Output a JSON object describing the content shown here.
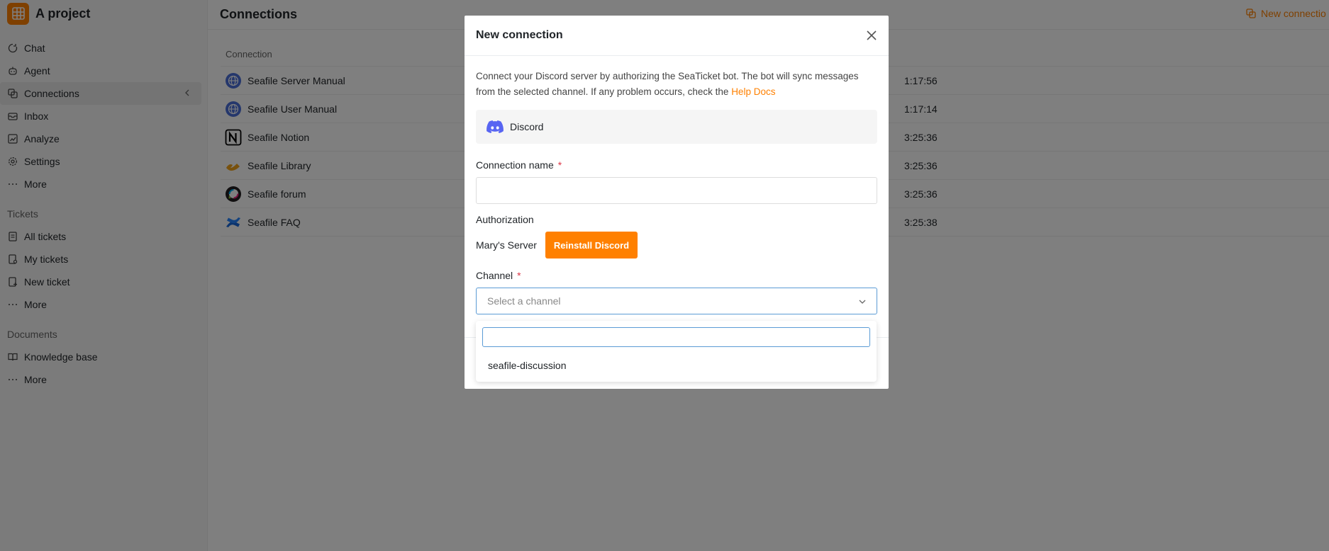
{
  "project": {
    "name": "A project",
    "logo_icon": "grid-icon",
    "accent": "#ff8000"
  },
  "sidebar": {
    "items": [
      {
        "label": "Chat",
        "icon": "chat-icon"
      },
      {
        "label": "Agent",
        "icon": "agent-icon"
      },
      {
        "label": "Connections",
        "icon": "connections-icon",
        "active": true
      },
      {
        "label": "Inbox",
        "icon": "inbox-icon"
      },
      {
        "label": "Analyze",
        "icon": "analyze-icon"
      },
      {
        "label": "Settings",
        "icon": "gear-icon"
      },
      {
        "label": "More",
        "icon": "ellipsis-icon"
      }
    ],
    "tickets_section": {
      "title": "Tickets",
      "items": [
        {
          "label": "All tickets",
          "icon": "tickets-list-icon"
        },
        {
          "label": "My tickets",
          "icon": "my-tickets-icon"
        },
        {
          "label": "New ticket",
          "icon": "new-ticket-icon"
        },
        {
          "label": "More",
          "icon": "ellipsis-icon"
        }
      ]
    },
    "documents_section": {
      "title": "Documents",
      "items": [
        {
          "label": "Knowledge base",
          "icon": "book-icon"
        },
        {
          "label": "More",
          "icon": "ellipsis-icon"
        }
      ]
    }
  },
  "main": {
    "title": "Connections",
    "new_connection_label": "New connectio",
    "table": {
      "column_header": "Connection",
      "rows": [
        {
          "name": "Seafile Server Manual",
          "time": "1:17:56",
          "icon": "globe-icon"
        },
        {
          "name": "Seafile User Manual",
          "time": "1:17:14",
          "icon": "globe-icon"
        },
        {
          "name": "Seafile Notion",
          "time": "3:25:36",
          "icon": "notion-icon"
        },
        {
          "name": "Seafile Library",
          "time": "3:25:36",
          "icon": "library-icon"
        },
        {
          "name": "Seafile forum",
          "time": "3:25:36",
          "icon": "discourse-icon"
        },
        {
          "name": "Seafile FAQ",
          "time": "3:25:38",
          "icon": "confluence-icon"
        }
      ]
    }
  },
  "modal": {
    "title": "New connection",
    "description": "Connect your Discord server by authorizing the SeaTicket bot. The bot will sync messages from the selected channel. If any problem occurs, check the ",
    "help_link": "Help Docs",
    "platform": "Discord",
    "connection_name_label": "Connection name",
    "required_mark": "*",
    "authorization_label": "Authorization",
    "server_name": "Mary's Server",
    "reinstall_button": "Reinstall Discord",
    "channel_label": "Channel",
    "channel_placeholder": "Select a channel",
    "dropdown_options": [
      "seafile-discussion"
    ]
  }
}
